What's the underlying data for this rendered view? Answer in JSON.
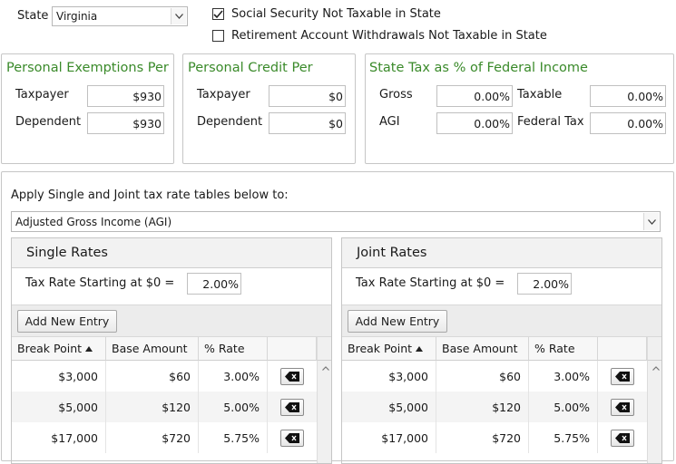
{
  "state": {
    "label": "State",
    "value": "Virginia"
  },
  "options": {
    "ss_not_taxable": {
      "label": "Social Security Not Taxable in State",
      "checked": true
    },
    "retirement_not_taxable": {
      "label": "Retirement Account Withdrawals Not Taxable in State",
      "checked": false
    }
  },
  "exemptions": {
    "title": "Personal Exemptions Per",
    "taxpayer_label": "Taxpayer",
    "taxpayer_value": "$930",
    "dependent_label": "Dependent",
    "dependent_value": "$930"
  },
  "credits": {
    "title": "Personal Credit Per",
    "taxpayer_label": "Taxpayer",
    "taxpayer_value": "$0",
    "dependent_label": "Dependent",
    "dependent_value": "$0"
  },
  "state_tax_pct": {
    "title": "State Tax as % of Federal Income",
    "gross_label": "Gross",
    "gross_value": "0.00%",
    "taxable_label": "Taxable",
    "taxable_value": "0.00%",
    "agi_label": "AGI",
    "agi_value": "0.00%",
    "fedtax_label": "Federal Tax",
    "fedtax_value": "0.00%"
  },
  "apply": {
    "label": "Apply Single and Joint tax rate tables below to:",
    "value": "Adjusted Gross Income (AGI)"
  },
  "single": {
    "title": "Single Rates",
    "start_label": "Tax Rate Starting at $0 =",
    "start_value": "2.00%",
    "add_label": "Add New Entry",
    "columns": {
      "break": "Break Point",
      "base": "Base Amount",
      "rate": "% Rate"
    },
    "rows": [
      {
        "break": "$3,000",
        "base": "$60",
        "rate": "3.00%"
      },
      {
        "break": "$5,000",
        "base": "$120",
        "rate": "5.00%"
      },
      {
        "break": "$17,000",
        "base": "$720",
        "rate": "5.75%"
      }
    ]
  },
  "joint": {
    "title": "Joint Rates",
    "start_label": "Tax Rate Starting at $0 =",
    "start_value": "2.00%",
    "add_label": "Add New Entry",
    "columns": {
      "break": "Break Point",
      "base": "Base Amount",
      "rate": "% Rate"
    },
    "rows": [
      {
        "break": "$3,000",
        "base": "$60",
        "rate": "3.00%"
      },
      {
        "break": "$5,000",
        "base": "$120",
        "rate": "5.00%"
      },
      {
        "break": "$17,000",
        "base": "$720",
        "rate": "5.75%"
      }
    ]
  },
  "colors": {
    "group_title": "#3a8a2a",
    "border": "#c6c6c6"
  },
  "icons": {
    "dropdown": "chevron-down-icon",
    "delete": "backspace-icon",
    "sort": "sort-asc-icon",
    "check": "check-icon"
  }
}
